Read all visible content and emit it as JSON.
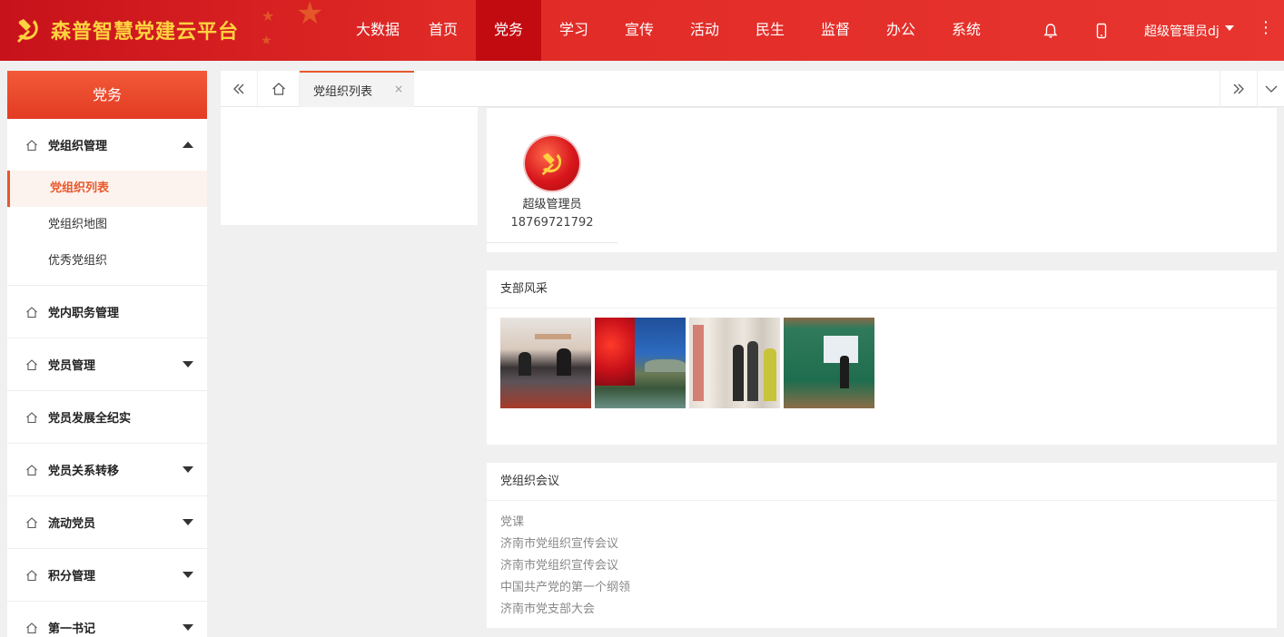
{
  "header": {
    "title": "森普智慧党建云平台",
    "nav": [
      {
        "label": "大数据",
        "active": false
      },
      {
        "label": "首页",
        "active": false
      },
      {
        "label": "党务",
        "active": true
      },
      {
        "label": "学习",
        "active": false
      },
      {
        "label": "宣传",
        "active": false
      },
      {
        "label": "活动",
        "active": false
      },
      {
        "label": "民生",
        "active": false
      },
      {
        "label": "监督",
        "active": false
      },
      {
        "label": "办公",
        "active": false
      },
      {
        "label": "系统",
        "active": false
      }
    ],
    "user": "超级管理员dj",
    "icons": [
      "bell-icon",
      "mobile-icon",
      "more-vertical-icon"
    ],
    "colors": {
      "primary": "#e02a26",
      "active_nav": "#c20b11",
      "title": "#ffd23f"
    }
  },
  "sidebar": {
    "title": "党务",
    "groups": [
      {
        "label": "党组织管理",
        "expanded": true,
        "has_children": true,
        "children": [
          {
            "label": "党组织列表",
            "active": true
          },
          {
            "label": "党组织地图",
            "active": false
          },
          {
            "label": "优秀党组织",
            "active": false
          }
        ]
      },
      {
        "label": "党内职务管理",
        "has_children": false
      },
      {
        "label": "党员管理",
        "has_children": true
      },
      {
        "label": "党员发展全纪实",
        "has_children": false
      },
      {
        "label": "党员关系转移",
        "has_children": true
      },
      {
        "label": "流动党员",
        "has_children": true
      },
      {
        "label": "积分管理",
        "has_children": true
      },
      {
        "label": "第一书记",
        "has_children": true
      }
    ],
    "accent": "#e8582c"
  },
  "tabs": {
    "items": [
      {
        "label": "党组织列表",
        "active": true,
        "close": "×"
      }
    ]
  },
  "profile": {
    "name": "超级管理员",
    "phone": "18769721792"
  },
  "branch": {
    "title": "支部风采",
    "photos": [
      "meeting-room-photo",
      "lake-autumn-photo",
      "exhibition-photo",
      "lecture-photo"
    ]
  },
  "meetings": {
    "title": "党组织会议",
    "items": [
      "党课",
      "济南市党组织宣传会议",
      "济南市党组织宣传会议",
      "中国共产党的第一个纲领",
      "济南市党支部大会"
    ]
  }
}
